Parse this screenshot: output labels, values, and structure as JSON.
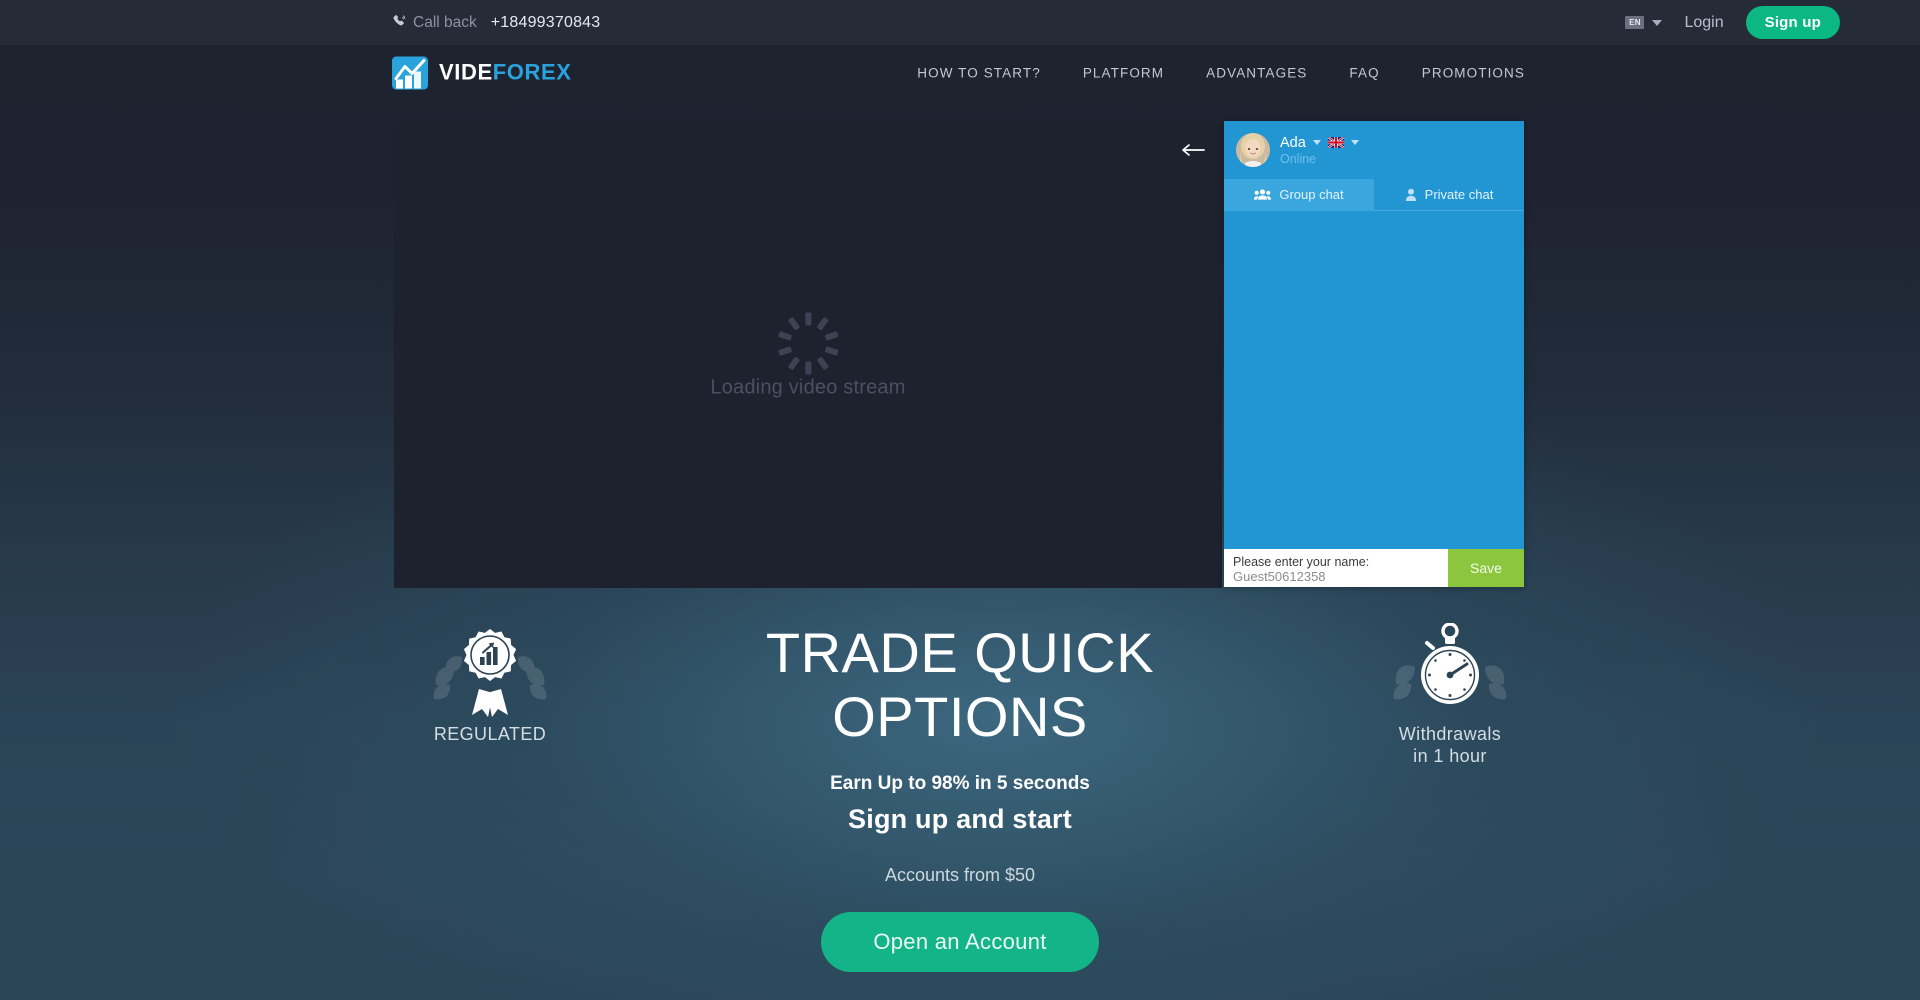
{
  "topbar": {
    "callback_icon": "phone-callback-icon",
    "callback_label": "Call back",
    "phone": "+18499370843",
    "lang_code": "EN",
    "login_label": "Login",
    "signup_label": "Sign up"
  },
  "brand": {
    "logo_icon": "videforex-chart-logo-icon",
    "name_part1": "VIDE",
    "name_part2": "FOREX"
  },
  "nav": {
    "items": [
      {
        "label": "HOW TO START?"
      },
      {
        "label": "PLATFORM"
      },
      {
        "label": "ADVANTAGES"
      },
      {
        "label": "FAQ"
      },
      {
        "label": "PROMOTIONS"
      }
    ]
  },
  "stream": {
    "loading_text": "Loading video stream",
    "spinner_icon": "loading-spinner-icon"
  },
  "collapse": {
    "icon": "arrow-left-icon"
  },
  "chat": {
    "operator_name": "Ada",
    "operator_status": "Online",
    "avatar_icon": "operator-avatar",
    "flag_icon": "uk-flag-icon",
    "tabs": [
      {
        "label": "Group chat",
        "icon": "group-chat-icon",
        "active": true
      },
      {
        "label": "Private chat",
        "icon": "private-chat-icon",
        "active": false
      }
    ],
    "name_label": "Please enter your name:",
    "name_value": "Guest50612358",
    "name_placeholder": "Guest50612358",
    "save_label": "Save"
  },
  "hero": {
    "feature_left": {
      "icon": "regulated-badge-icon",
      "caption": "REGULATED"
    },
    "feature_right": {
      "icon": "stopwatch-icon",
      "caption_line1": "Withdrawals",
      "caption_line2": "in 1 hour"
    },
    "title_line1": "TRADE QUICK",
    "title_line2": "OPTIONS",
    "subtitle1": "Earn Up to 98% in 5 seconds",
    "subtitle2": "Sign up and start",
    "accounts_note": "Accounts from $50",
    "cta_label": "Open an Account"
  },
  "colors": {
    "accent_green": "#0bb783",
    "cta_green": "#12b488",
    "save_green": "#8cc63f",
    "chat_blue": "#2196d3",
    "chat_tab_active": "#39a6de",
    "logo_blue": "#2aa3dd",
    "topbar_bg": "#262b38",
    "stream_bg": "#1d222e"
  }
}
